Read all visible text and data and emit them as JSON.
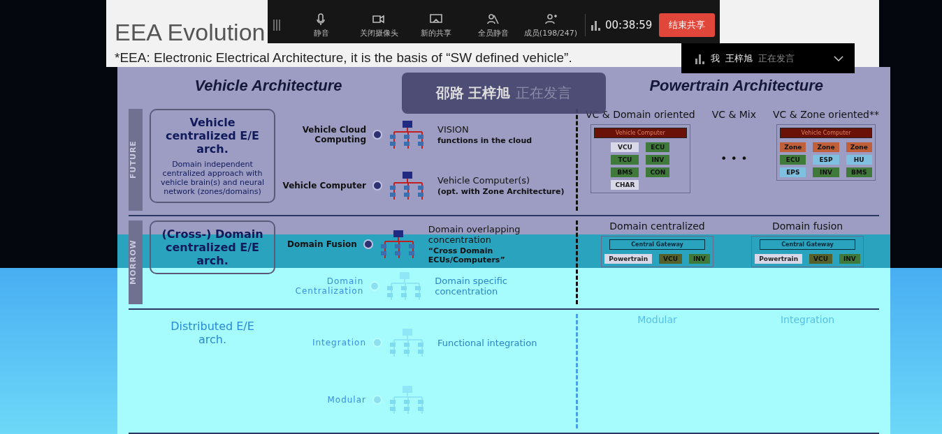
{
  "toolbar": {
    "items": [
      {
        "kind": "mic",
        "label": "静音"
      },
      {
        "kind": "camera",
        "label": "关闭摄像头"
      },
      {
        "kind": "share",
        "label": "新的共享"
      },
      {
        "kind": "mute_all",
        "label": "全员静音"
      },
      {
        "kind": "members",
        "label": "成员(198/247)"
      }
    ],
    "timer": "00:38:59",
    "end_button": "结束共享"
  },
  "speaker_panel": {
    "me": "我",
    "name": "王梓旭",
    "status": "正在发言"
  },
  "speaking_banner": {
    "names": "邵路 王梓旭",
    "status": "正在发言"
  },
  "slide": {
    "title": "EEA Evolution",
    "subtitle": "*EEA: Electronic Electrical Architecture, it is the basis of “SW defined vehicle”.",
    "left_heading": "Vehicle Architecture",
    "right_heading": "Powertrain Architecture",
    "rows": [
      {
        "tag": "FUTURE",
        "card": {
          "title": "Vehicle centralized E/E arch.",
          "text": "Domain independent centralized approach with vehicle brain(s) and neural network (zones/domains)",
          "faded": false
        },
        "steps": [
          {
            "label": "Vehicle Cloud Computing",
            "title": "VISION",
            "note": "functions in the cloud",
            "faded": false
          },
          {
            "label": "Vehicle Computer",
            "title": "Vehicle Computer(s)",
            "note": "(opt. with Zone Architecture)",
            "faded": false
          }
        ],
        "variants": [
          {
            "kind": "domain",
            "title": "VC & Domain oriented",
            "header": "Vehicle Computer",
            "boxes": [
              {
                "kind": "plain",
                "label": "VCU"
              },
              {
                "kind": "green",
                "label": "ECU"
              },
              {
                "kind": "green",
                "label": "TCU"
              },
              {
                "kind": "green",
                "label": "INV"
              },
              {
                "kind": "green",
                "label": "BMS"
              },
              {
                "kind": "green",
                "label": "CON"
              },
              {
                "kind": "plain",
                "label": "CHAR"
              }
            ],
            "faded": false
          },
          {
            "kind": "ellipsis",
            "title": "VC & Mix",
            "mark": "• • •",
            "faded": false
          },
          {
            "kind": "zone",
            "title": "VC & Zone oriented**",
            "header": "Vehicle Computer",
            "boxes": [
              {
                "kind": "orange",
                "label": "Zone"
              },
              {
                "kind": "orange",
                "label": "Zone"
              },
              {
                "kind": "orange",
                "label": "Zone"
              },
              {
                "kind": "green",
                "label": "ECU"
              },
              {
                "kind": "blue",
                "label": "ESP"
              },
              {
                "kind": "blue",
                "label": "HU"
              },
              {
                "kind": "blue",
                "label": "EPS"
              },
              {
                "kind": "green",
                "label": "INV"
              },
              {
                "kind": "green",
                "label": "BMS"
              }
            ],
            "faded": false
          }
        ]
      },
      {
        "tag": "MORROW",
        "card": {
          "title": "(Cross-) Domain centralized E/E arch.",
          "faded": false
        },
        "steps": [
          {
            "label": "Domain Fusion",
            "title": "Domain overlapping concentration",
            "note": "“Cross Domain ECUs/Computers”",
            "faded": false
          },
          {
            "label": "Domain Centralization",
            "title": "Domain specific concentration",
            "faded": true
          }
        ],
        "variants": [
          {
            "kind": "gateway",
            "title": "Domain centralized",
            "header": "Central Gateway",
            "boxes": [
              {
                "kind": "plain",
                "label": "Powertrain"
              },
              {
                "kind": "olive",
                "label": "VCU"
              },
              {
                "kind": "green",
                "label": "INV"
              }
            ],
            "faded": false
          },
          {
            "kind": "gateway",
            "title": "Domain fusion",
            "header": "Central Gateway",
            "boxes": [
              {
                "kind": "plain",
                "label": "Powertrain"
              },
              {
                "kind": "olive",
                "label": "VCU"
              },
              {
                "kind": "green",
                "label": "INV"
              }
            ],
            "faded": false
          }
        ]
      },
      {
        "card": {
          "title": "Distributed E/E arch.",
          "faded": true
        },
        "steps": [
          {
            "label": "Integration",
            "title": "Functional integration",
            "faded": true
          },
          {
            "label": "Modular",
            "faded": true
          }
        ],
        "variants": [
          {
            "kind": "faint",
            "title": "Modular",
            "faded": true
          },
          {
            "kind": "faint",
            "title": "Integration",
            "faded": true
          }
        ]
      }
    ]
  }
}
